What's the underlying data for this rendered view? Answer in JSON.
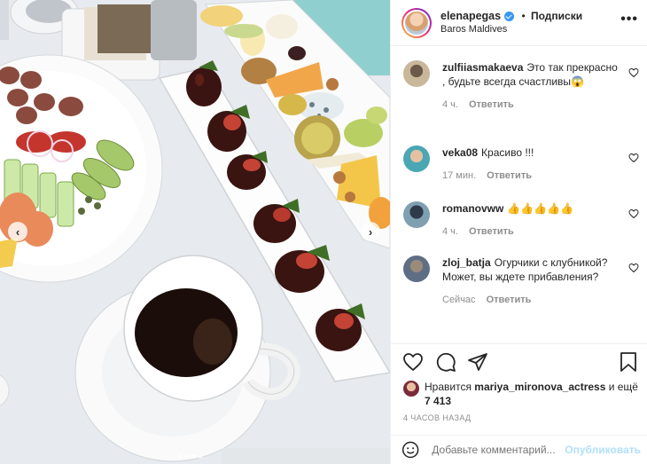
{
  "header": {
    "username": "elenapegas",
    "separator": "•",
    "follow_label": "Подписки",
    "location": "Baros Maldives",
    "more_label": "•••"
  },
  "photo": {
    "nav_prev": "‹",
    "nav_next": "›"
  },
  "comments": [
    {
      "user": "zulfiiasmakaeva",
      "text": "Это так прекрасно , будьте всегда счастливы😱",
      "time": "4 ч.",
      "reply": "Ответить"
    },
    {
      "user": "veka08",
      "text": "Красиво !!!",
      "time": "17 мин.",
      "reply": "Ответить"
    },
    {
      "user": "romanovww",
      "text": "👍👍👍👍👍",
      "time": "4 ч.",
      "reply": "Ответить"
    },
    {
      "user": "zloj_batja",
      "text": "Огурчики с клубникой? Может, вы ждете прибавления?",
      "time": "Сейчас",
      "reply": "Ответить"
    }
  ],
  "likes": {
    "prefix": "Нравится ",
    "user": "mariya_mironova_actress",
    "middle": " и ещё ",
    "count": "7 413"
  },
  "time_ago": "4 ЧАСОВ НАЗАД",
  "add_comment": {
    "placeholder": "Добавьте комментарий...",
    "publish_label": "Опубликовать"
  },
  "colors": {
    "verified": "#3897f0",
    "publish": "#b2dffc",
    "meta": "#8e8e8e"
  }
}
